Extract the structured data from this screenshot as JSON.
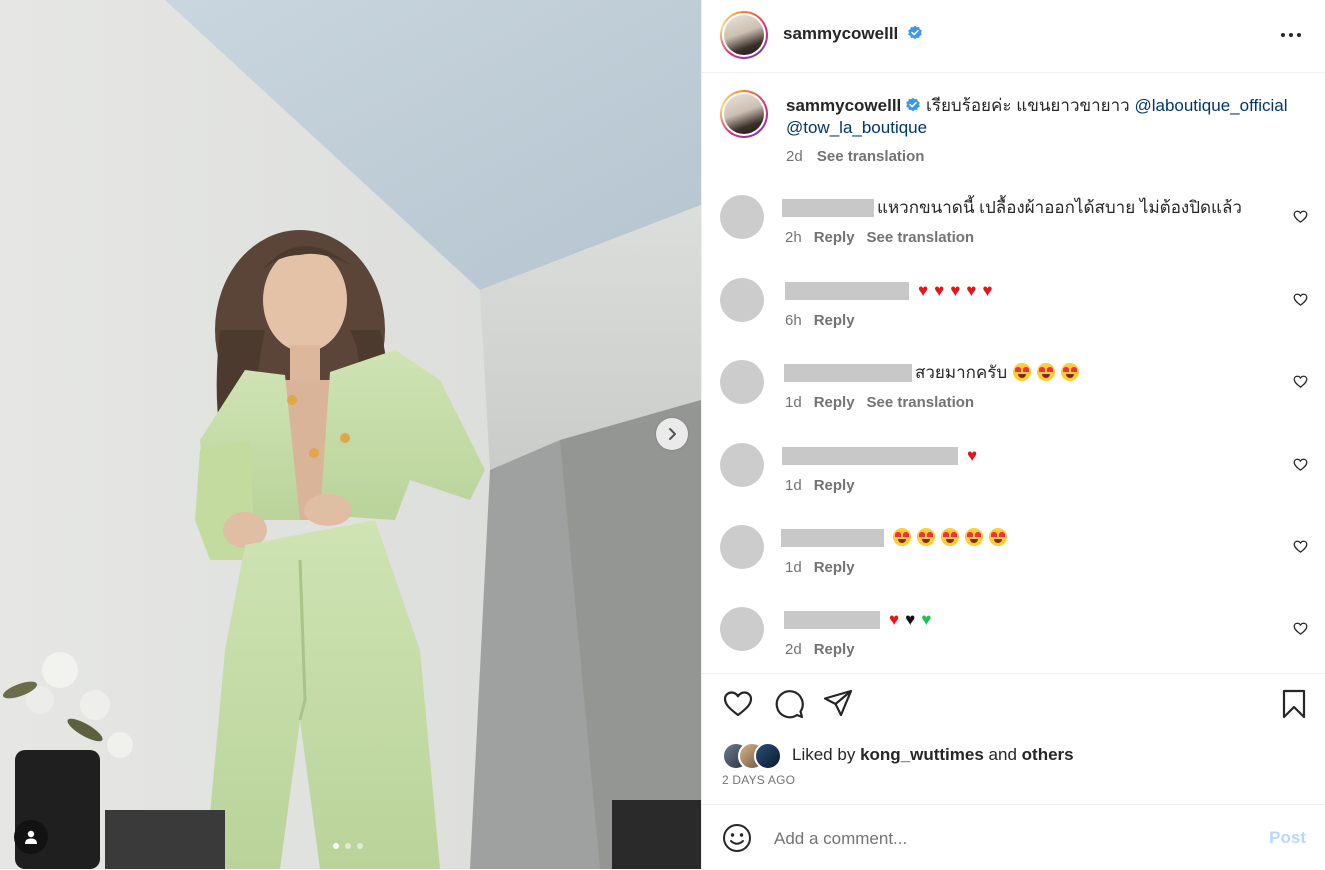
{
  "photo": {
    "carousel_dots": [
      true,
      false,
      false
    ],
    "icons": {
      "next": "chevron-right-icon",
      "tags": "user-tag-icon"
    }
  },
  "header": {
    "username": "sammycowelll",
    "verified": true,
    "more_icon": "more-horizontal-icon"
  },
  "caption": {
    "username": "sammycowelll",
    "text": "เรียบร้อยค่ะ แขนยาวขายาว",
    "mentions": [
      "@laboutique_official",
      "@tow_la_boutique"
    ],
    "age": "2d",
    "translate_label": "See translation"
  },
  "comments": [
    {
      "text": "แหวกขนาดนี้ เปลื้องผ้าออกได้สบาย ไม่ต้องปิดแล้ว",
      "emojis": [],
      "age": "2h",
      "reply": "Reply",
      "translate": "See translation"
    },
    {
      "text": "",
      "emojis": [
        "heart",
        "heart",
        "heart",
        "heart",
        "heart"
      ],
      "age": "6h",
      "reply": "Reply",
      "translate": ""
    },
    {
      "text": "สวยมากครับ",
      "emojis": [
        "heart-eyes",
        "heart-eyes",
        "heart-eyes"
      ],
      "age": "1d",
      "reply": "Reply",
      "translate": "See translation"
    },
    {
      "text": "",
      "emojis": [
        "heart"
      ],
      "age": "1d",
      "reply": "Reply",
      "translate": ""
    },
    {
      "text": "",
      "emojis": [
        "heart-eyes",
        "heart-eyes",
        "heart-eyes",
        "heart-eyes",
        "heart-eyes"
      ],
      "age": "1d",
      "reply": "Reply",
      "translate": ""
    },
    {
      "text": "",
      "emojis": [
        "heart",
        "black-heart",
        "green-heart"
      ],
      "age": "2d",
      "reply": "Reply",
      "translate": ""
    }
  ],
  "actions": {
    "like_icon": "heart-icon",
    "comment_icon": "comment-icon",
    "share_icon": "share-icon",
    "save_icon": "bookmark-icon"
  },
  "likes": {
    "prefix": "Liked by",
    "user": "kong_wuttimes",
    "conj": "and",
    "others": "others"
  },
  "post_age": "2 DAYS AGO",
  "add_comment": {
    "placeholder": "Add a comment...",
    "post_label": "Post",
    "emoji_icon": "smiley-icon"
  },
  "colors": {
    "link": "#00376b",
    "muted": "#737373",
    "verified": "#3897f0",
    "post_disabled": "#b6d9fb",
    "heart_red": "#e8141b"
  }
}
